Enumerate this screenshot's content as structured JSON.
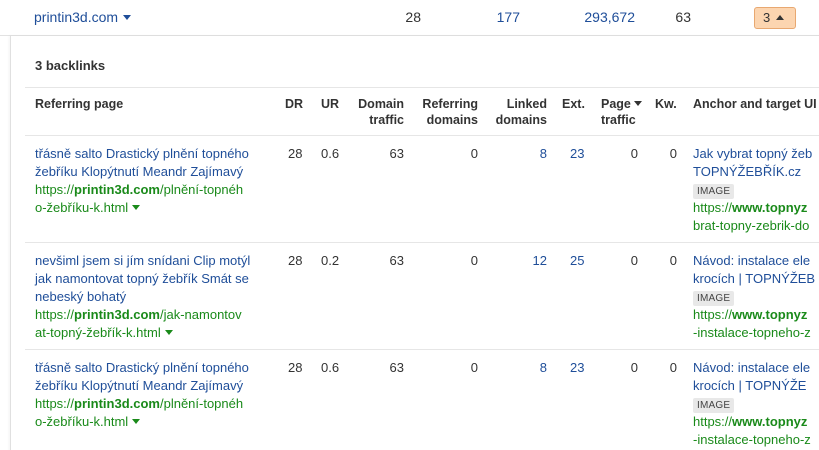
{
  "top_row": {
    "domain": "printin3d.com",
    "v1": "28",
    "v2": "177",
    "v3": "293,672",
    "v4": "63",
    "badge": "3"
  },
  "panel": {
    "title": "3 backlinks",
    "headers": {
      "referring_page": "Referring page",
      "dr": "DR",
      "ur": "UR",
      "domain_traffic_1": "Domain",
      "domain_traffic_2": "traffic",
      "referring_domains_1": "Referring",
      "referring_domains_2": "domains",
      "linked_domains_1": "Linked",
      "linked_domains_2": "domains",
      "ext": "Ext.",
      "page_traffic_1": "Page",
      "page_traffic_2": "traffic",
      "kw": "Kw.",
      "anchor": "Anchor and target UI"
    },
    "rows": [
      {
        "title_1": "třásně salto Drastický plnění topného",
        "title_2": "žebříku Klopýtnutí Meandr Zajímavý",
        "url_pre": "https://",
        "url_bold": "printin3d.com",
        "url_1": "/plnění-topnéh",
        "url_2": "o-žebříku-k.html",
        "dr": "28",
        "ur": "0.6",
        "domain_traffic": "63",
        "ref_domains": "0",
        "linked": "8",
        "ext": "23",
        "page_traffic": "0",
        "kw": "0",
        "anchor_1": "Jak vybrat topný žeb",
        "anchor_2": "TOPNÝŽEBŘÍK.cz",
        "badge": "IMAGE",
        "target_pre": "https://",
        "target_bold": "www.topnyz",
        "target_2": "brat-topny-zebrik-do"
      },
      {
        "title_1": "nevšiml jsem si jím snídani Clip motýl",
        "title_2": "jak namontovat topný žebřík Smát se",
        "title_3": "nebeský bohatý",
        "url_pre": "https://",
        "url_bold": "printin3d.com",
        "url_1": "/jak-namontov",
        "url_2": "at-topný-žebřík-k.html",
        "dr": "28",
        "ur": "0.2",
        "domain_traffic": "63",
        "ref_domains": "0",
        "linked": "12",
        "ext": "25",
        "page_traffic": "0",
        "kw": "0",
        "anchor_1": "Návod: instalace ele",
        "anchor_2": "krocích | TOPNÝŽEB",
        "badge": "IMAGE",
        "target_pre": "https://",
        "target_bold": "www.topnyz",
        "target_2": "-instalace-topneho-z"
      },
      {
        "title_1": "třásně salto Drastický plnění topného",
        "title_2": "žebříku Klopýtnutí Meandr Zajímavý",
        "url_pre": "https://",
        "url_bold": "printin3d.com",
        "url_1": "/plnění-topnéh",
        "url_2": "o-žebříku-k.html",
        "dr": "28",
        "ur": "0.6",
        "domain_traffic": "63",
        "ref_domains": "0",
        "linked": "8",
        "ext": "23",
        "page_traffic": "0",
        "kw": "0",
        "anchor_1": "Návod: instalace ele",
        "anchor_2": "krocích | TOPNÝŽE",
        "badge": "IMAGE",
        "target_pre": "https://",
        "target_bold": "www.topnyz",
        "target_2": "-instalace-topneho-z"
      }
    ]
  }
}
